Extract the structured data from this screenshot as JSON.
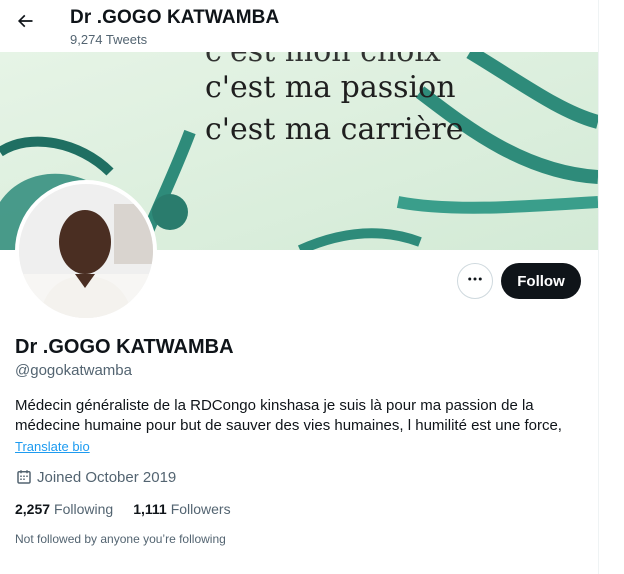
{
  "header": {
    "title": "Dr .GOGO KATWAMBA",
    "tweet_count": "9,274 Tweets",
    "back_icon": "arrow-left-icon"
  },
  "banner": {
    "lines": [
      "c'est mon choix",
      "c'est ma passion",
      "c'est ma carrière"
    ]
  },
  "profile": {
    "name": "Dr .GOGO KATWAMBA",
    "handle": "@gogokatwamba",
    "bio_lines": [
      "Médecin généraliste de la RDCongo kinshasa je suis là pour ma passion de la",
      "médecine humaine pour but de sauver des vies humaines, l humilité est une force,"
    ],
    "translate_label": "Translate bio",
    "joined": "Joined October 2019",
    "following_count": "2,257",
    "following_label": "Following",
    "followers_count": "1,111",
    "followers_label": "Followers",
    "not_followed": "Not followed by anyone you’re following"
  },
  "actions": {
    "more_icon": "more-dots-icon",
    "follow_label": "Follow"
  },
  "colors": {
    "text_primary": "#0f1419",
    "text_secondary": "#536471",
    "link": "#1d9bf0",
    "follow_bg": "#0f1419",
    "banner_teal": "#2e8b7a"
  }
}
